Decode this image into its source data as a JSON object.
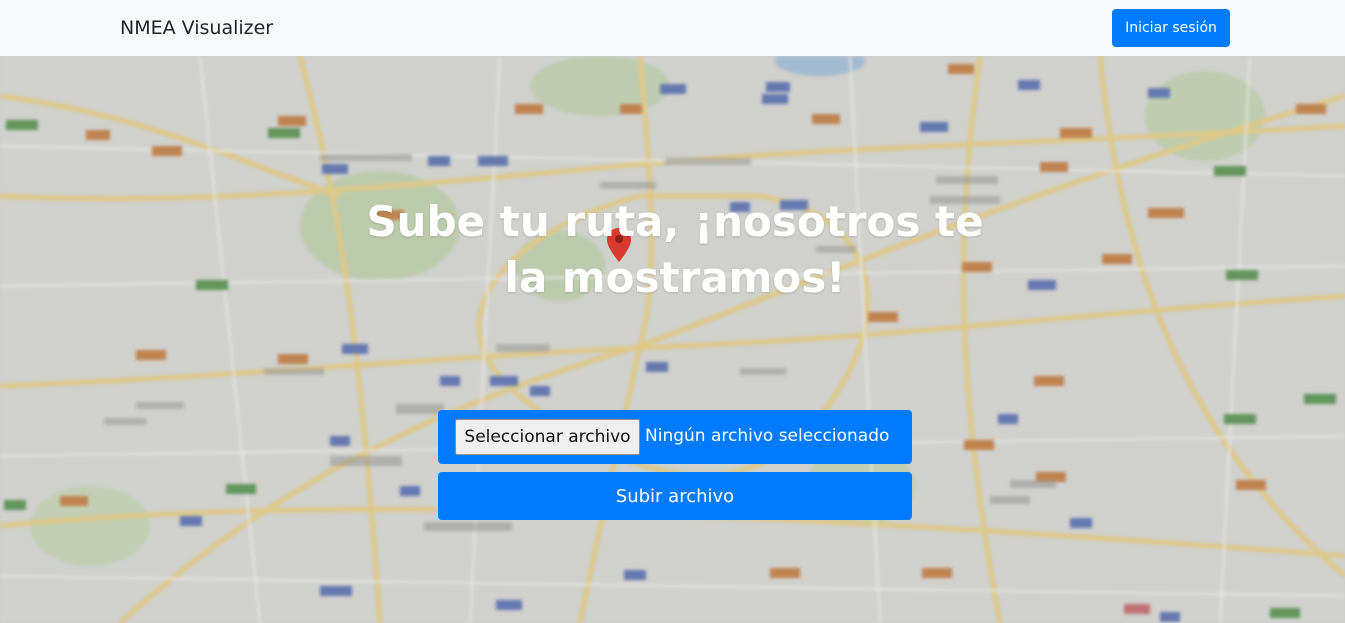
{
  "navbar": {
    "brand": "NMEA Visualizer",
    "login_label": "Iniciar sesión"
  },
  "hero": {
    "title": "Sube tu ruta, ¡nosotros te la mostramos!"
  },
  "upload": {
    "choose_file_label": "Seleccionar archivo",
    "no_file_text": "Ningún archivo seleccionado",
    "submit_label": "Subir archivo"
  },
  "colors": {
    "primary": "#007bff",
    "navbar_bg": "#f8f9fa",
    "brand_text": "#212529"
  },
  "icons": [
    "map-marker-icon"
  ]
}
